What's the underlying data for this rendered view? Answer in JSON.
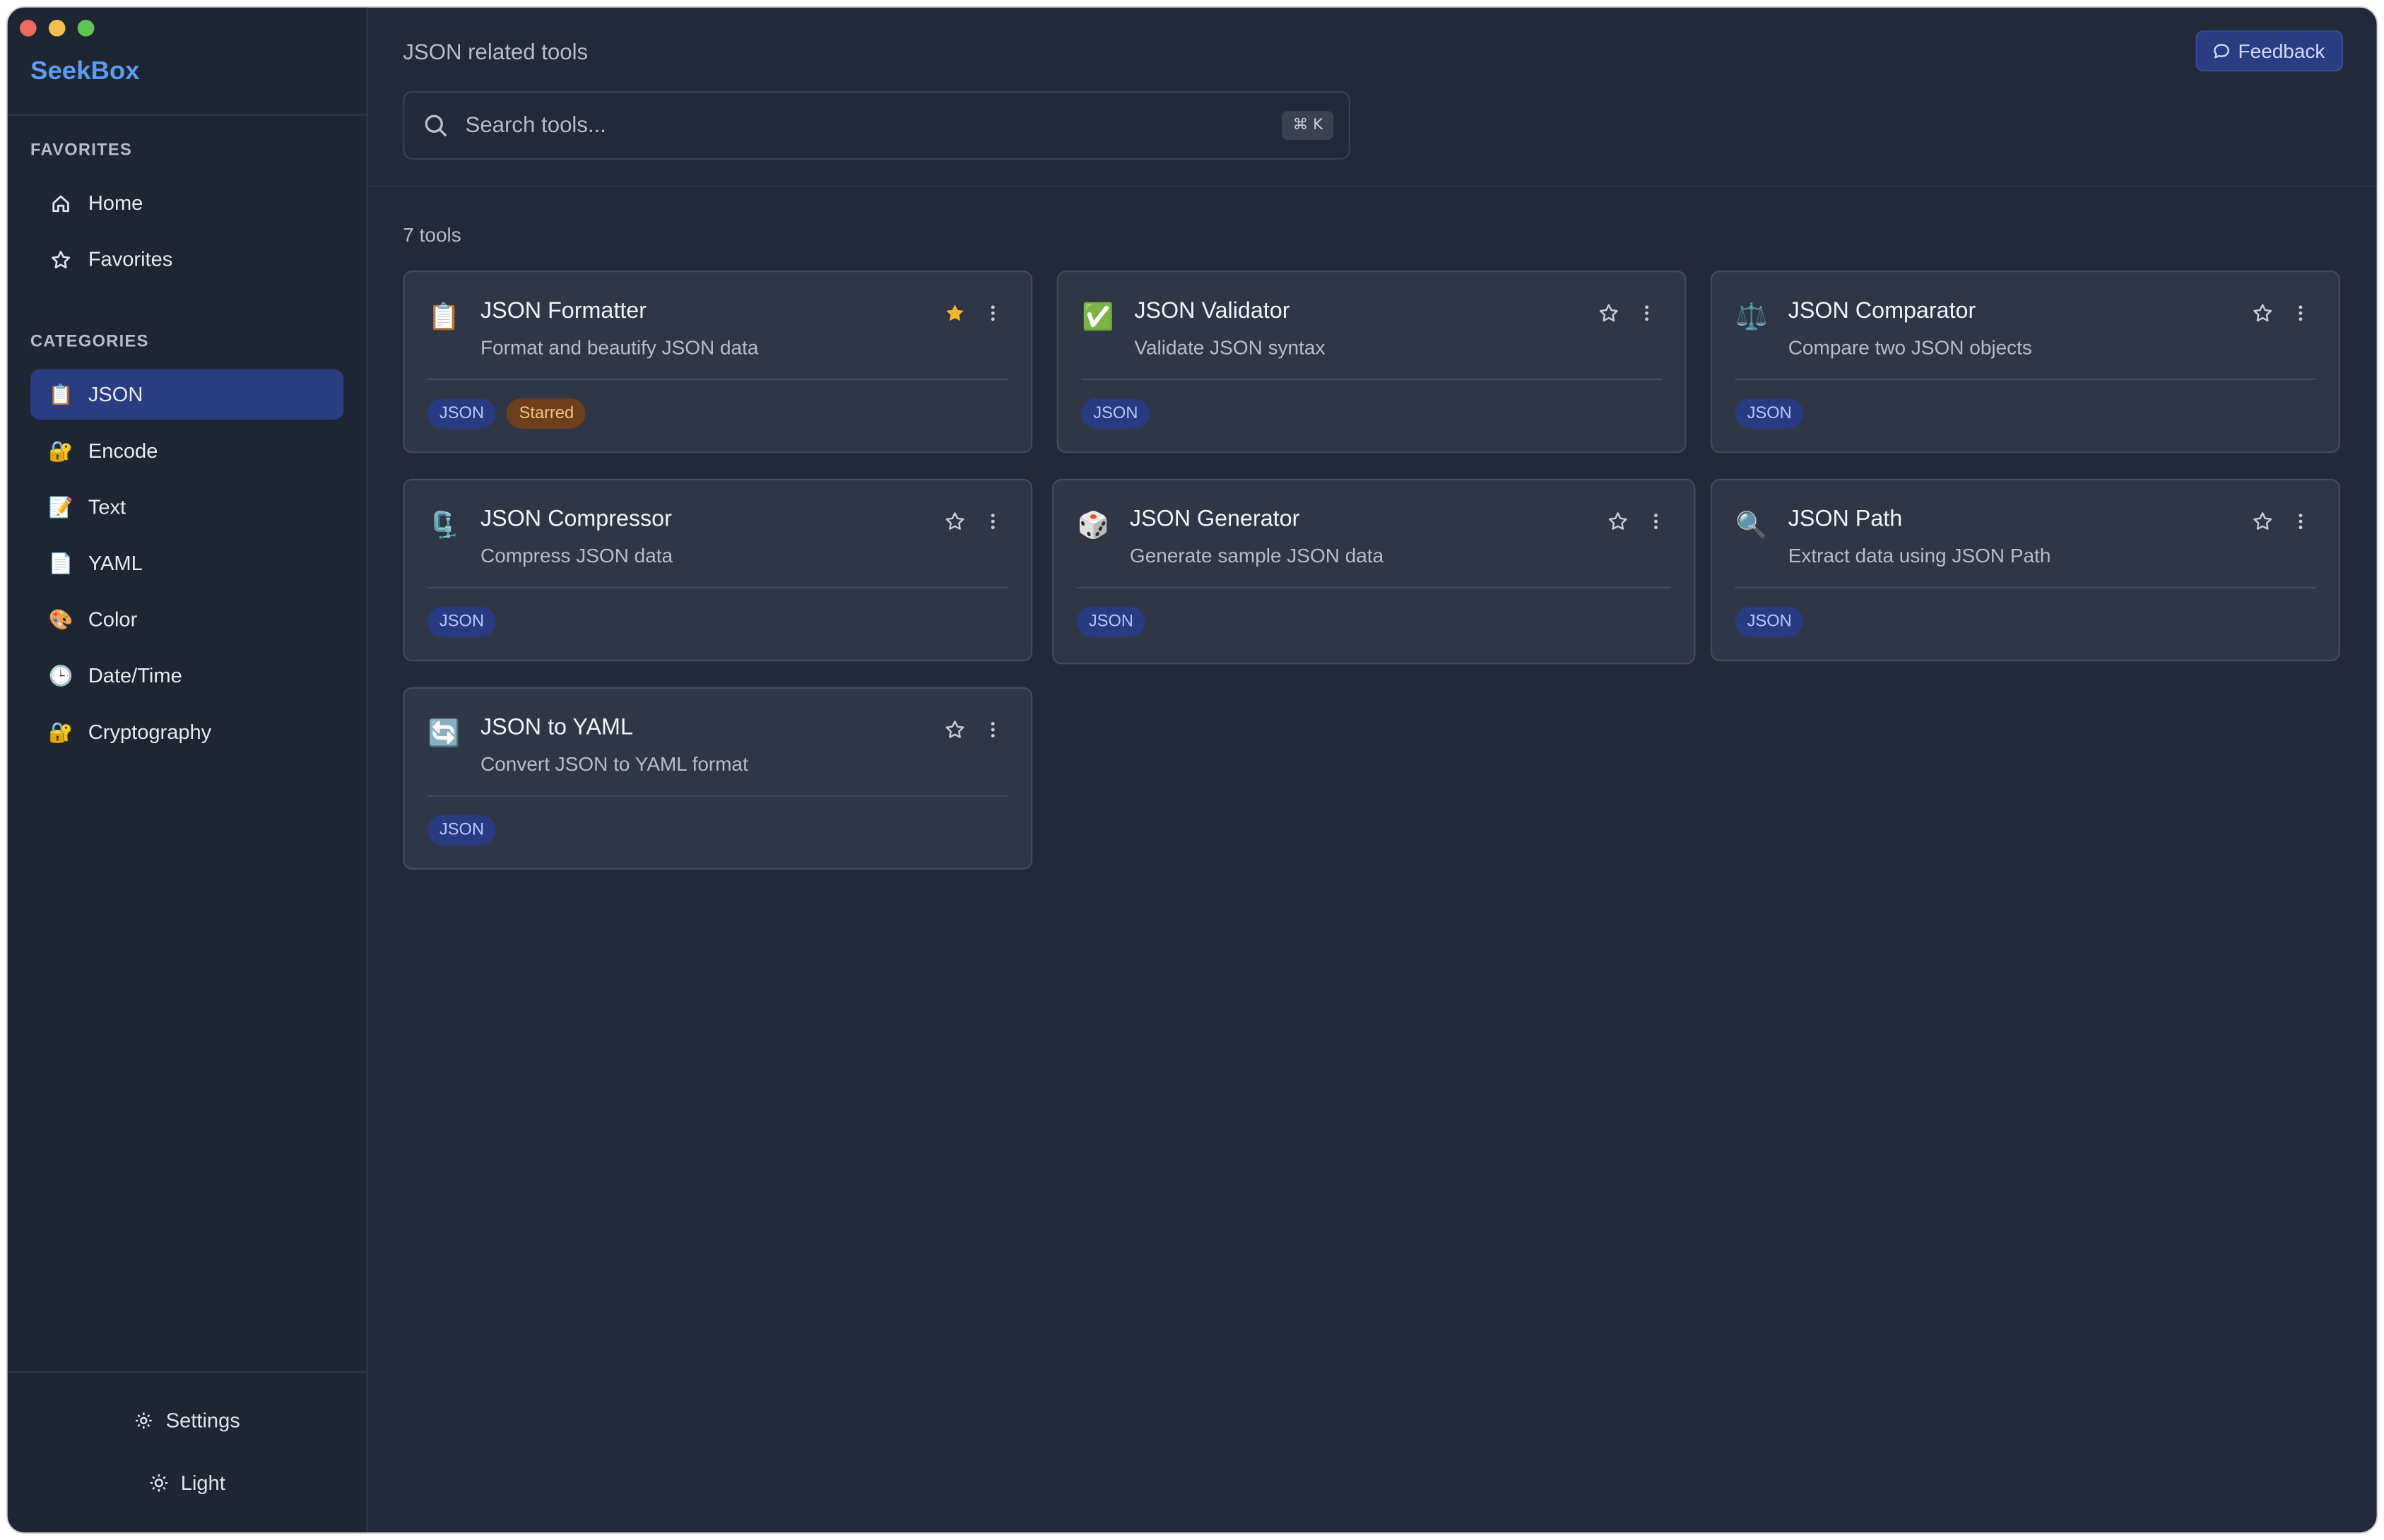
{
  "app": {
    "name": "SeekBox",
    "accent": "#5b9bf0",
    "active_bg": "#2b3d82"
  },
  "sidebar": {
    "favorites_title": "FAVORITES",
    "favorites": [
      {
        "label": "Home",
        "icon": "home-icon"
      },
      {
        "label": "Favorites",
        "icon": "star-outline-icon"
      }
    ],
    "categories_title": "CATEGORIES",
    "categories": [
      {
        "label": "JSON",
        "icon": "clipboard-icon",
        "active": true
      },
      {
        "label": "Encode",
        "icon": "lock-key-icon"
      },
      {
        "label": "Text",
        "icon": "memo-icon"
      },
      {
        "label": "YAML",
        "icon": "page-icon"
      },
      {
        "label": "Color",
        "icon": "palette-icon"
      },
      {
        "label": "Date/Time",
        "icon": "clock-icon"
      },
      {
        "label": "Cryptography",
        "icon": "lock-key-icon"
      }
    ],
    "settings_label": "Settings",
    "theme_label": "Light"
  },
  "header": {
    "breadcrumb": "JSON related tools",
    "feedback_label": "Feedback",
    "search_placeholder": "Search tools...",
    "shortcut": "⌘ K"
  },
  "main": {
    "tool_count": "7 tools",
    "tools": [
      {
        "title": "JSON Formatter",
        "desc": "Format and beautify JSON data",
        "icon": "clipboard-icon",
        "starred": true,
        "tags": [
          "JSON"
        ],
        "starred_label": "Starred"
      },
      {
        "title": "JSON Validator",
        "desc": "Validate JSON syntax",
        "icon": "check-box-icon",
        "starred": false,
        "tags": [
          "JSON"
        ]
      },
      {
        "title": "JSON Comparator",
        "desc": "Compare two JSON objects",
        "icon": "balance-scale-icon",
        "starred": false,
        "tags": [
          "JSON"
        ]
      },
      {
        "title": "JSON Compressor",
        "desc": "Compress JSON data",
        "icon": "clamp-icon",
        "starred": false,
        "tags": [
          "JSON"
        ]
      },
      {
        "title": "JSON Generator",
        "desc": "Generate sample JSON data",
        "icon": "dice-icon",
        "starred": false,
        "tags": [
          "JSON"
        ]
      },
      {
        "title": "JSON Path",
        "desc": "Extract data using JSON Path",
        "icon": "magnifier-icon",
        "starred": false,
        "tags": [
          "JSON"
        ]
      },
      {
        "title": "JSON to YAML",
        "desc": "Convert JSON to YAML format",
        "icon": "refresh-icon",
        "starred": false,
        "tags": [
          "JSON"
        ]
      }
    ]
  }
}
